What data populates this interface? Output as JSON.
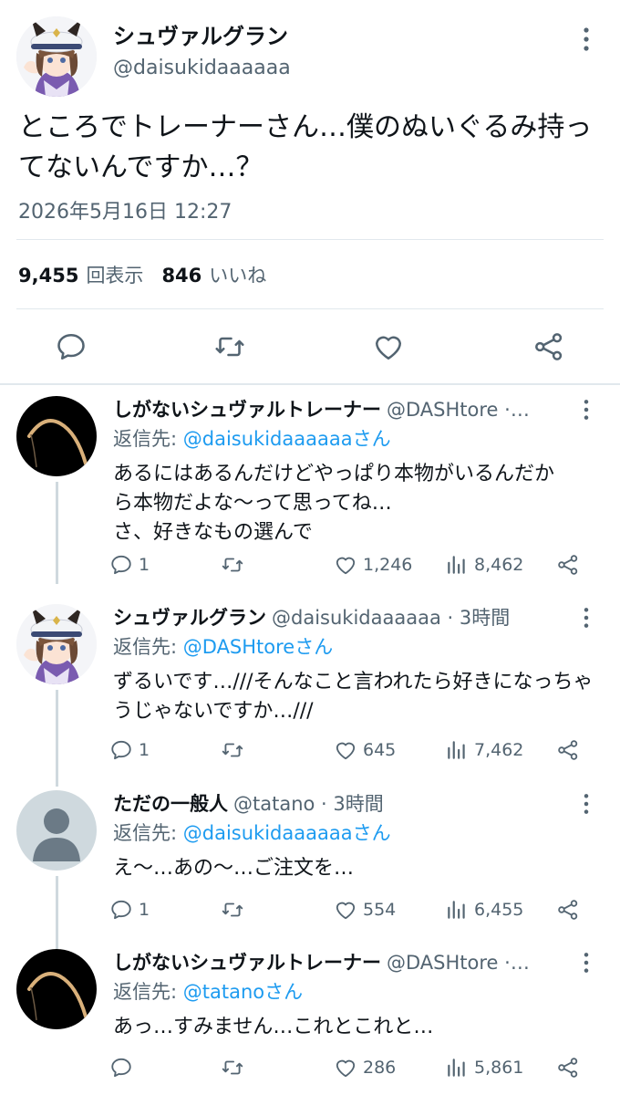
{
  "main_tweet": {
    "author_name": "シュヴァルグラン",
    "author_handle": "@daisukidaaaaaa",
    "text": "ところでトレーナーさん…僕のぬいぐるみ持ってないんですか…？",
    "timestamp": "2026年5月16日 12:27",
    "views_count": "9,455",
    "views_label": "回表示",
    "likes_count": "846",
    "likes_label": "いいね"
  },
  "replies": [
    {
      "author_name": "しがないシュヴァルトレーナー",
      "author_handle": "@DASHtore ·…",
      "reply_to_label": "返信先:",
      "reply_to_link": "@daisukidaaaaaaさん",
      "text": "あるにはあるんだけどやっぱり本物がいるんだから本物だよな〜って思ってね…\nさ、好きなもの選んで",
      "replies": "1",
      "likes": "1,246",
      "views": "8,462"
    },
    {
      "author_name": "シュヴァルグラン",
      "author_handle": "@daisukidaaaaaa · 3時間",
      "reply_to_label": "返信先:",
      "reply_to_link": "@DASHtoreさん",
      "text": "ずるいです…///そんなこと言われたら好きになっちゃうじゃないですか…///",
      "replies": "1",
      "likes": "645",
      "views": "7,462"
    },
    {
      "author_name": "ただの一般人",
      "author_handle": "@tatano · 3時間",
      "reply_to_label": "返信先:",
      "reply_to_link": "@daisukidaaaaaaさん",
      "text": "え〜…あの〜…ご注文を…",
      "replies": "1",
      "likes": "554",
      "views": "6,455"
    },
    {
      "author_name": "しがないシュヴァルトレーナー",
      "author_handle": "@DASHtore ·…",
      "reply_to_label": "返信先:",
      "reply_to_link": "@tatanoさん",
      "text": "あっ…すみません…これとこれと…",
      "replies": "",
      "likes": "286",
      "views": "5,861"
    }
  ],
  "icons": {
    "reply": "speech-bubble-icon",
    "retweet": "retweet-icon",
    "like": "heart-icon",
    "views": "bar-chart-icon",
    "share": "share-icon",
    "more": "vertical-dots-icon"
  },
  "colors": {
    "link": "#1d9bf0",
    "secondary_text": "#536471",
    "divider": "#e1e8ed"
  }
}
